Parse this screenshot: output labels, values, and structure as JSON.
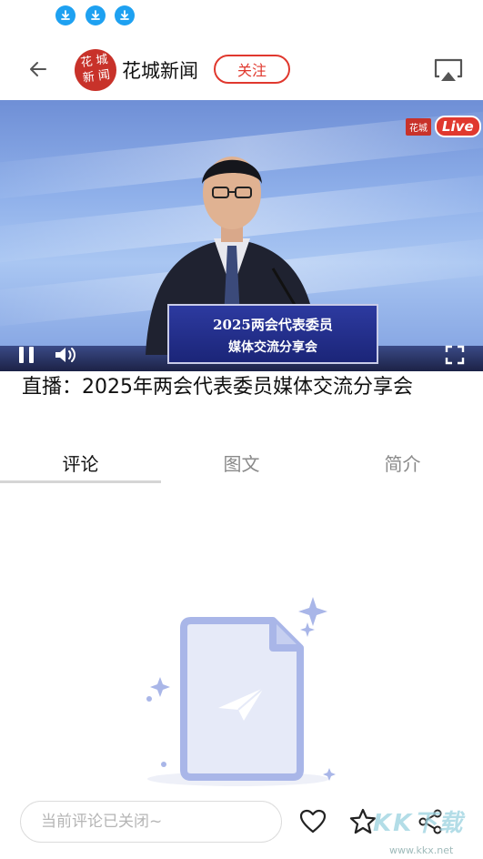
{
  "status_bar": {
    "icons": [
      "download-icon",
      "download-icon",
      "download-icon"
    ],
    "accent_color": "#1ea1f1"
  },
  "header": {
    "channel_name": "花城新闻",
    "logo_text": [
      "花",
      "城",
      "新",
      "闻"
    ],
    "follow_label": "关注",
    "brand_color": "#e0382e"
  },
  "video": {
    "live_brand": "花城",
    "live_label": "Live",
    "podium_line1": "2025两会代表委员",
    "podium_line2": "媒体交流分享会"
  },
  "title": "直播：2025年两会代表委员媒体交流分享会",
  "tabs": [
    {
      "label": "评论",
      "active": true
    },
    {
      "label": "图文",
      "active": false
    },
    {
      "label": "简介",
      "active": false
    }
  ],
  "bottom_bar": {
    "comment_placeholder": "当前评论已关闭~",
    "watermark": "KK下载",
    "watermark_url": "www.kkx.net"
  }
}
